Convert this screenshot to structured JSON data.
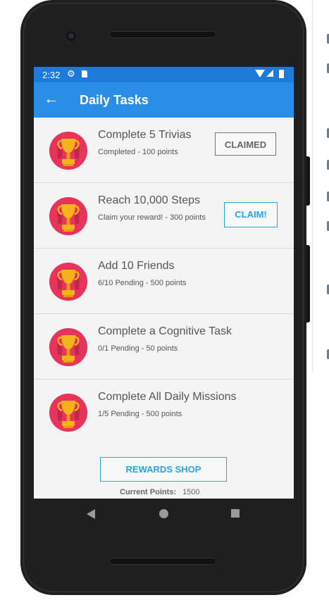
{
  "status_bar": {
    "time": "2:32"
  },
  "app_bar": {
    "back_glyph": "←",
    "title": "Daily Tasks"
  },
  "tasks": [
    {
      "title": "Complete 5 Trivias",
      "subtitle": "Completed - 100 points",
      "action": "CLAIMED"
    },
    {
      "title": "Reach 10,000 Steps",
      "subtitle": "Claim your reward! - 300 points",
      "action": "CLAIM!"
    },
    {
      "title": "Add 10 Friends",
      "subtitle": "6/10 Pending - 500 points",
      "action": ""
    },
    {
      "title": "Complete a Cognitive Task",
      "subtitle": "0/1 Pending - 50 points",
      "action": ""
    },
    {
      "title": "Complete All Daily Missions",
      "subtitle": "1/5 Pending - 500 points",
      "action": ""
    }
  ],
  "footer": {
    "shop_button": "REWARDS SHOP",
    "points_label": "Current Points:",
    "points_value": "1500"
  },
  "colors": {
    "status_bar": "#1d7ad8",
    "app_bar": "#2b8ee6",
    "accent": "#26a4e5",
    "trophy_bg": "#e8335a",
    "trophy_gold": "#f5b21c"
  },
  "icons": {
    "back": "arrow-left-icon",
    "task": "trophy-icon",
    "settings": "gear-icon"
  }
}
